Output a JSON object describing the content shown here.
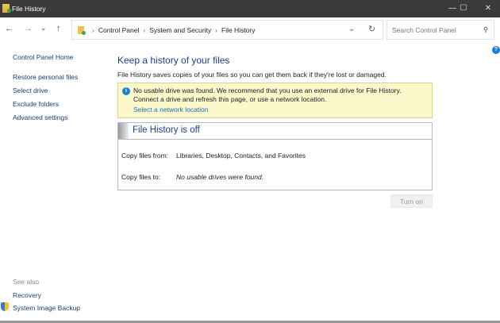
{
  "window": {
    "title": "File History",
    "minimize": "—",
    "maximize": "☐",
    "close": "✕"
  },
  "nav": {
    "back": "←",
    "forward": "→",
    "recent": "⌄",
    "up": "↑"
  },
  "address": {
    "crumbs": [
      "Control Panel",
      "System and Security",
      "File History"
    ],
    "dropdown": "⌄",
    "refresh": "↻"
  },
  "search": {
    "placeholder": "Search Control Panel",
    "icon": "⚲"
  },
  "sidebar": {
    "home": "Control Panel Home",
    "items": [
      "Restore personal files",
      "Select drive",
      "Exclude folders",
      "Advanced settings"
    ],
    "see_also": "See also",
    "links": [
      "Recovery",
      "System Image Backup"
    ]
  },
  "main": {
    "title": "Keep a history of your files",
    "description": "File History saves copies of your files so you can get them back if they're lost or damaged.",
    "warning": {
      "text": "No usable drive was found. We recommend that you use an external drive for File History. Connect a drive and refresh this page, or use a network location.",
      "link": "Select a network location"
    },
    "status": {
      "title": "File History is off",
      "from_label": "Copy files from:",
      "from_value": "Libraries, Desktop, Contacts, and Favorites",
      "to_label": "Copy files to:",
      "to_value": "No usable drives were found."
    },
    "turn_on": "Turn on"
  },
  "help": "?"
}
